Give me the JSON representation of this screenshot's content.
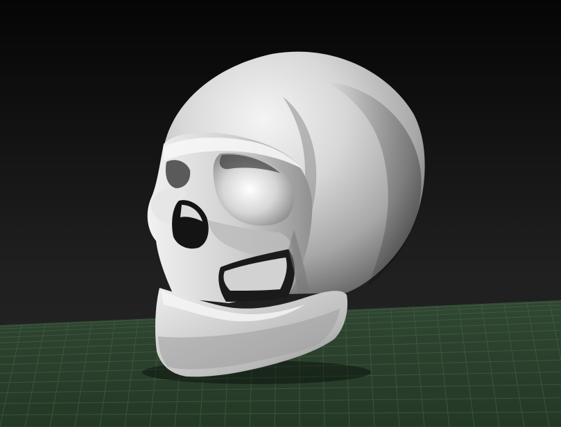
{
  "viewport": {
    "background_color": "#1b1b1b",
    "floor_color": "#2f4733",
    "grid_color": "#4c6b4c",
    "model_color": "#d9d9d9"
  },
  "scene": {
    "object": "skull",
    "floor_grid_visible": true
  }
}
